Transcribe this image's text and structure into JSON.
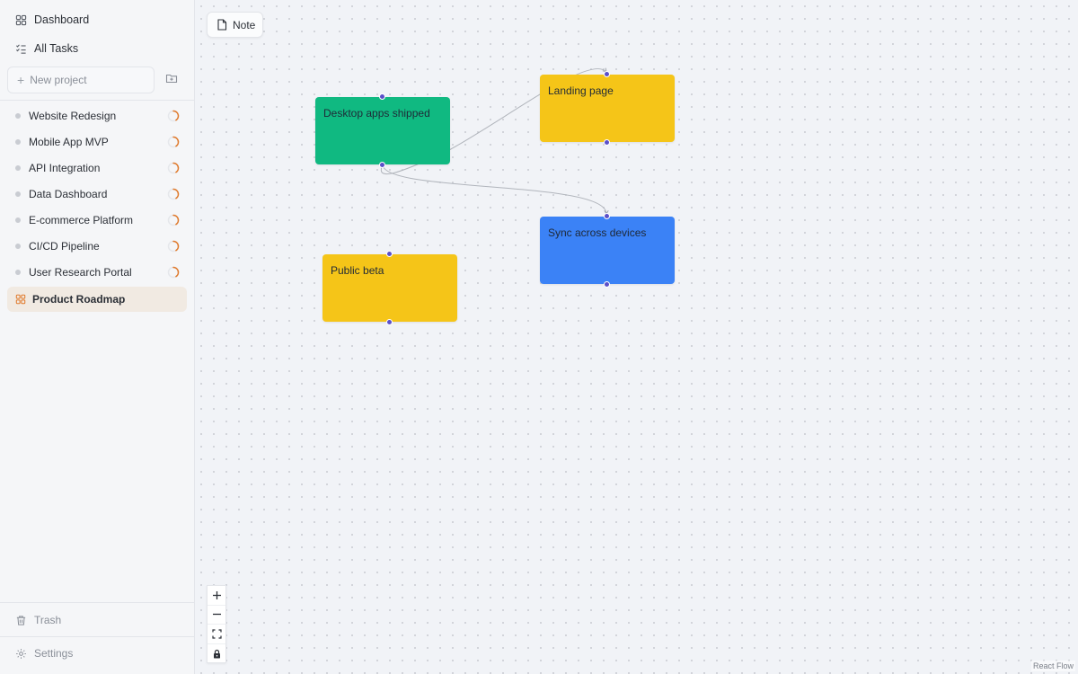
{
  "sidebar": {
    "nav": [
      {
        "label": "Dashboard",
        "icon": "grid-icon"
      },
      {
        "label": "All Tasks",
        "icon": "checklist-icon"
      }
    ],
    "new_project": {
      "label": "New project",
      "folder_icon": "folder-plus-icon"
    },
    "projects": [
      {
        "label": "Website Redesign"
      },
      {
        "label": "Mobile App MVP"
      },
      {
        "label": "API Integration"
      },
      {
        "label": "Data Dashboard"
      },
      {
        "label": "E-commerce Platform"
      },
      {
        "label": "CI/CD Pipeline"
      },
      {
        "label": "User Research Portal"
      },
      {
        "label": "Product Roadmap",
        "active": true
      }
    ],
    "bottom": [
      {
        "label": "Trash",
        "icon": "trash-icon"
      },
      {
        "label": "Settings",
        "icon": "gear-icon"
      }
    ]
  },
  "canvas": {
    "toolbar": {
      "note_label": "Note"
    },
    "nodes": [
      {
        "id": "desktop",
        "label": "Desktop apps shipped",
        "color": "#10b981"
      },
      {
        "id": "landing",
        "label": "Landing page",
        "color": "#f5c518"
      },
      {
        "id": "sync",
        "label": "Sync across devices",
        "color": "#3b82f6"
      },
      {
        "id": "beta",
        "label": "Public beta",
        "color": "#f5c518"
      }
    ],
    "edges": [
      {
        "from": "desktop",
        "to": "landing"
      },
      {
        "from": "desktop",
        "to": "sync"
      }
    ],
    "controls": [
      "zoom-in-icon",
      "zoom-out-icon",
      "fit-view-icon",
      "lock-icon"
    ],
    "attribution": "React Flow"
  },
  "colors": {
    "accent": "#e07a2c",
    "handle": "#5b50c9",
    "active_bg": "#f1eae2"
  }
}
